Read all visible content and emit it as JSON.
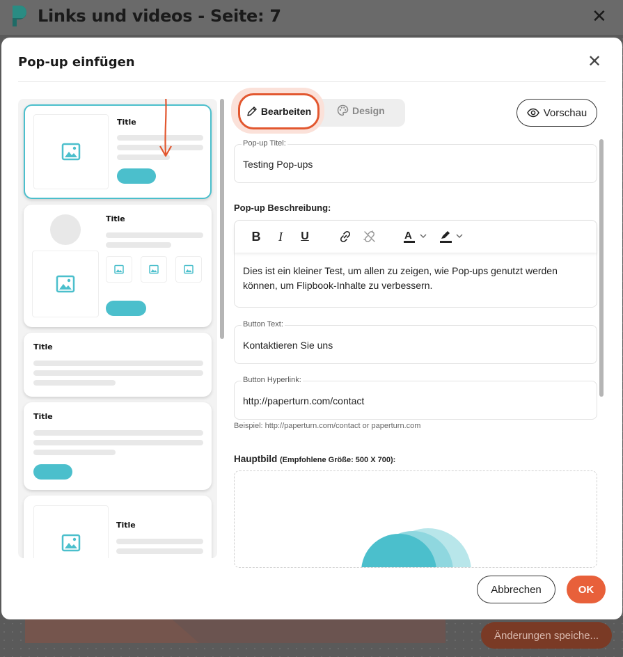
{
  "app": {
    "title": "Links und videos - Seite: 7",
    "save_button": "Änderungen speiche..."
  },
  "modal": {
    "title": "Pop-up einfügen",
    "templates": [
      {
        "title": "Title"
      },
      {
        "title": "Title"
      },
      {
        "title": "Title"
      },
      {
        "title": "Title"
      },
      {
        "title": "Title"
      }
    ],
    "tabs": {
      "edit": "Bearbeiten",
      "design": "Design"
    },
    "preview_button": "Vorschau",
    "popup_title": {
      "label": "Pop-up Titel:",
      "value": "Testing Pop-ups"
    },
    "description": {
      "label": "Pop-up Beschreibung:",
      "text": "Dies ist ein kleiner Test, um allen zu zeigen, wie Pop-ups genutzt werden können, um Flipbook-Inhalte zu verbessern.",
      "toolbar": [
        "bold-icon",
        "italic-icon",
        "underline-icon",
        "link-icon",
        "unlink-icon",
        "text-color-icon",
        "highlight-icon"
      ]
    },
    "button_text": {
      "label": "Button Text:",
      "value": "Kontaktieren Sie uns"
    },
    "button_hyperlink": {
      "label": "Button Hyperlink:",
      "value": "http://paperturn.com/contact",
      "hint": "Beispiel: http://paperturn.com/contact or paperturn.com"
    },
    "main_image": {
      "label": "Hauptbild",
      "size_hint": "(Empfohlene Größe: 500 X 700):"
    },
    "cancel_button": "Abbrechen",
    "ok_button": "OK"
  },
  "colors": {
    "accent": "#4bbfcc",
    "primary": "#e8603a",
    "highlight_ring": "#e2572f"
  }
}
